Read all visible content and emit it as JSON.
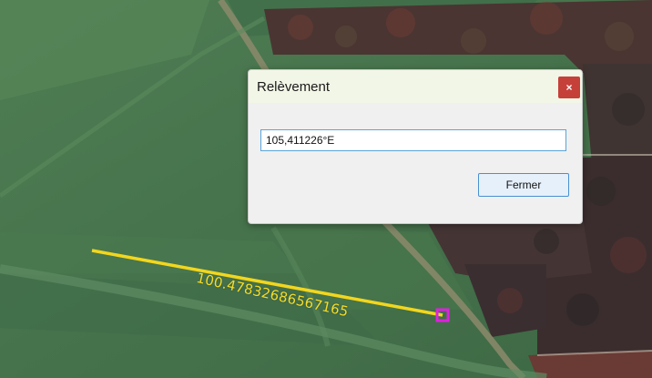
{
  "map": {
    "measure_label": "100.47832686567165",
    "line_color": "#f2d61e",
    "marker_color": "#e020e0"
  },
  "dialog": {
    "title": "Relèvement",
    "close_icon": "×",
    "value": "105,411226°E",
    "close_button_label": "Fermer"
  }
}
